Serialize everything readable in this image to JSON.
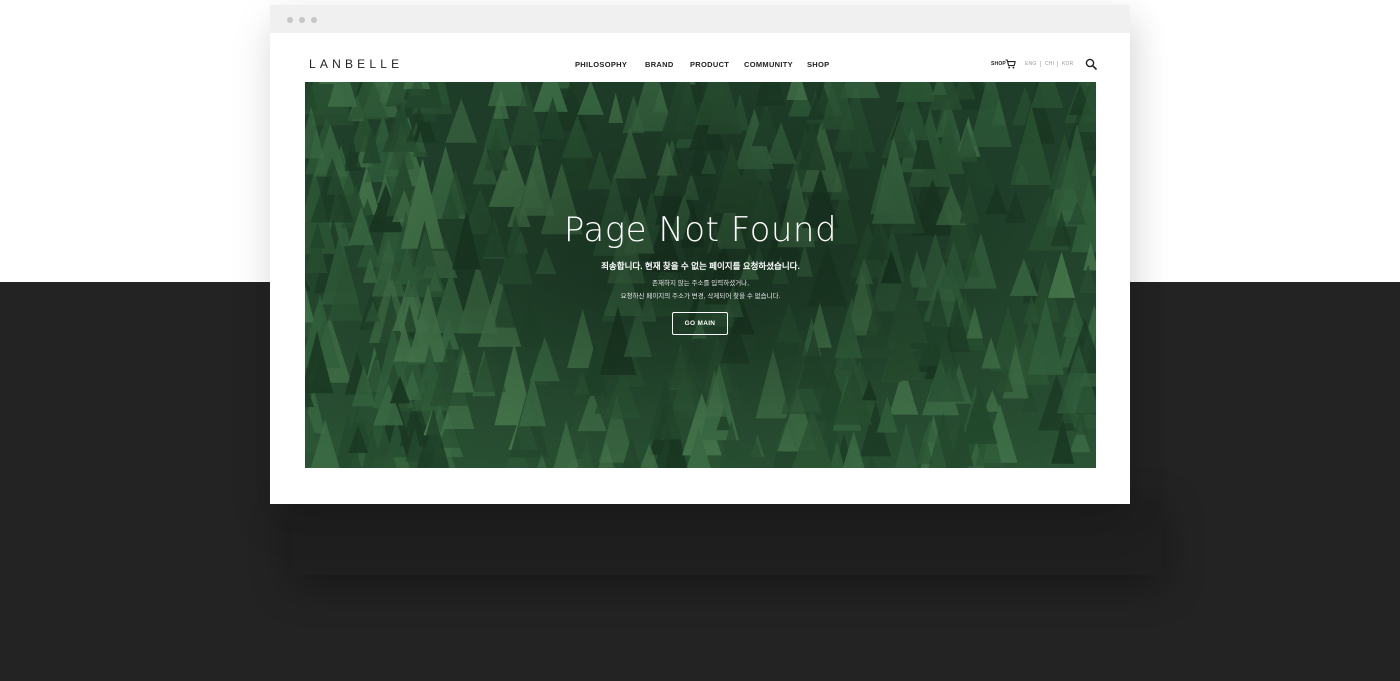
{
  "brand": {
    "logo": "LANBELLE"
  },
  "nav": {
    "items": [
      {
        "label": "PHILOSOPHY"
      },
      {
        "label": "BRAND"
      },
      {
        "label": "PRODUCT"
      },
      {
        "label": "COMMUNITY"
      },
      {
        "label": "SHOP"
      }
    ]
  },
  "utility": {
    "shop_label": "SHOP",
    "languages": [
      "ENG",
      "CHI",
      "KOR"
    ]
  },
  "icons": {
    "cart": "cart-icon",
    "search": "search-icon"
  },
  "hero": {
    "title": "Page Not Found",
    "message_main": "죄송합니다. 현재 찾을 수 없는 페이지를 요청하셨습니다.",
    "message_line1": "존재하지 않는 주소를 입력하셨거나,",
    "message_line2": "요청하신 페이지의 주소가 변경, 삭제되어 찾을 수 없습니다.",
    "button_label": "GO MAIN"
  },
  "colors": {
    "page_dark_bg": "#232323",
    "hero_green": "#1c3524",
    "text_dark": "#222222"
  }
}
